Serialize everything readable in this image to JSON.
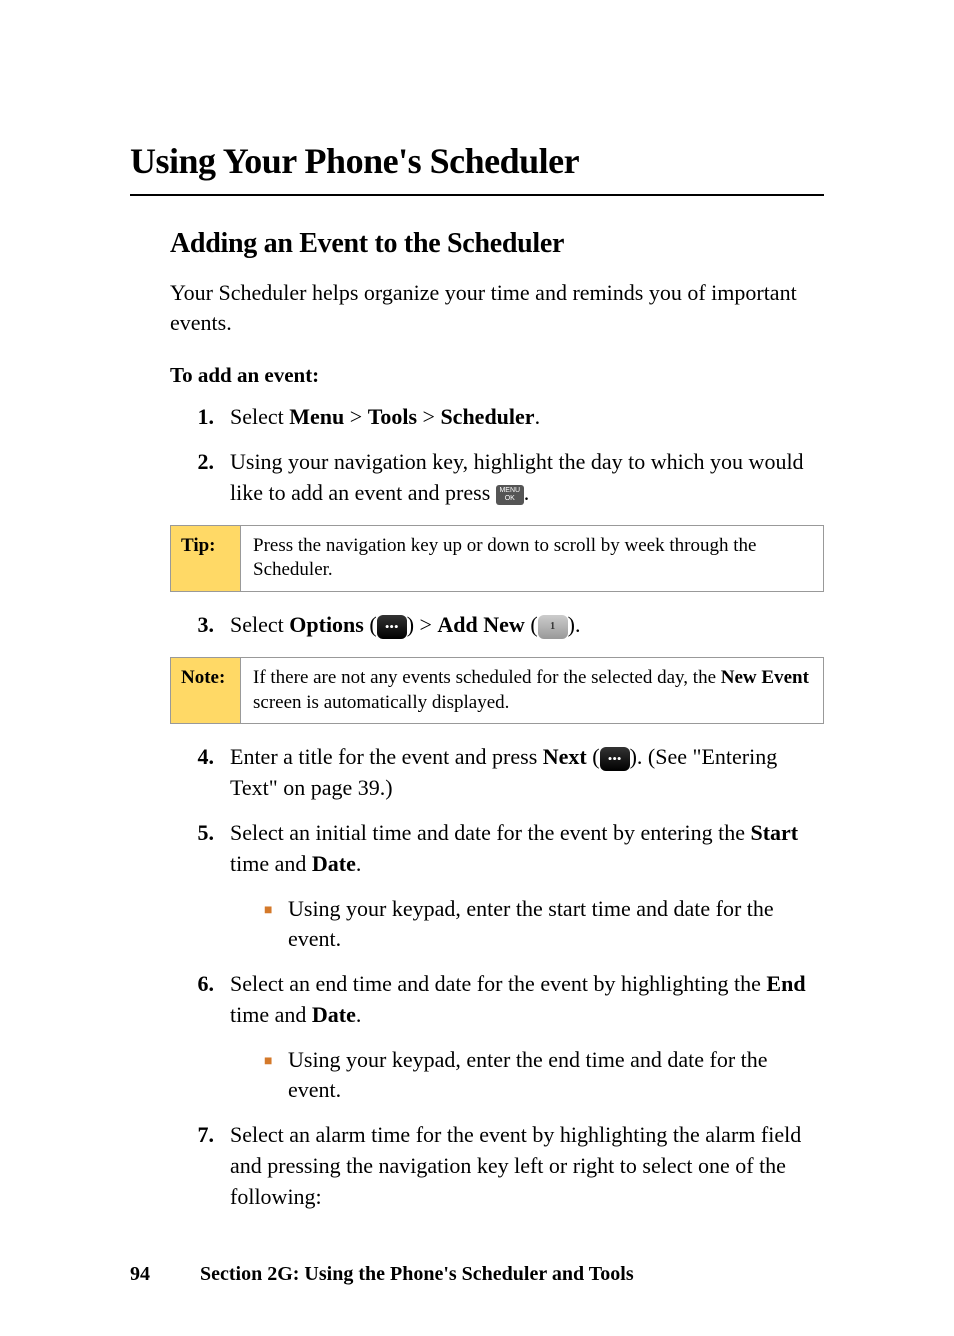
{
  "h1": "Using Your Phone's Scheduler",
  "h2": "Adding an Event to the Scheduler",
  "intro": "Your Scheduler helps organize your time and reminds you of important events.",
  "procTitle": "To add an event:",
  "steps": {
    "s1": {
      "num": "1.",
      "pre": "Select ",
      "b1": "Menu",
      "sep1": " > ",
      "b2": "Tools",
      "sep2": " > ",
      "b3": "Scheduler",
      "post": "."
    },
    "s2": {
      "num": "2.",
      "pre": "Using your navigation key, highlight the day to which you would like to add an event and press ",
      "post": "."
    },
    "s3": {
      "num": "3.",
      "pre": "Select ",
      "b1": "Options",
      "sep1": " (",
      "sep2": ") > ",
      "b2": "Add New",
      "sep3": " (",
      "post": ")."
    },
    "s4": {
      "num": "4.",
      "pre": "Enter a title for the event and press ",
      "b1": "Next",
      "sep1": " (",
      "sep2": "). (See \"Entering Text\" on page 39.)"
    },
    "s5": {
      "num": "5.",
      "pre": "Select an initial time and date for the event by entering the ",
      "b1": "Start",
      "mid": " time and ",
      "b2": "Date",
      "post": "."
    },
    "s5sub": "Using your keypad, enter the start time and date for the event.",
    "s6": {
      "num": "6.",
      "pre": "Select an end time and date for the event by highlighting the ",
      "b1": "End",
      "mid": " time and ",
      "b2": "Date",
      "post": "."
    },
    "s6sub": "Using your keypad, enter the end time and date for the event.",
    "s7": {
      "num": "7.",
      "text": "Select an alarm time for the event by highlighting the alarm field and pressing the navigation key left or right to select one of the following:"
    }
  },
  "tip": {
    "label": "Tip:",
    "body": "Press the navigation key up or down to scroll by week through the Scheduler."
  },
  "note": {
    "label": "Note:",
    "pre": "If there are not any events scheduled for the selected day, the ",
    "b": "New Event",
    "post": " screen is automatically displayed."
  },
  "footer": {
    "page": "94",
    "section": "Section 2G: Using the Phone's Scheduler and Tools"
  },
  "icons": {
    "menuOk": "MENU\nOK",
    "dots": "•••",
    "one": "1"
  }
}
